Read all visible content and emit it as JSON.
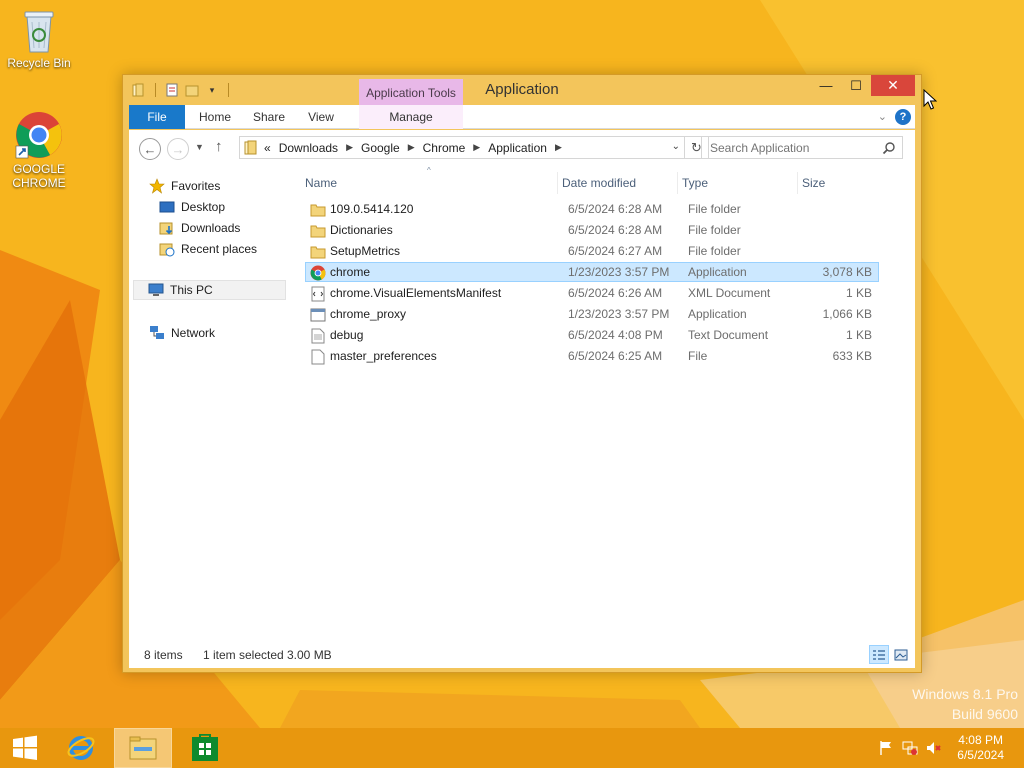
{
  "desktop": {
    "icons": [
      {
        "label": "Recycle Bin",
        "icon": "recycle-bin-icon"
      },
      {
        "label": "GOOGLE CHROME",
        "icon": "chrome-shortcut-icon"
      }
    ],
    "watermark_line1": "Windows 8.1 Pro",
    "watermark_line2": "Build 9600"
  },
  "window": {
    "title": "Application",
    "context_tab_group": "Application Tools",
    "ribbon_tabs": {
      "file": "File",
      "home": "Home",
      "share": "Share",
      "view": "View",
      "manage": "Manage"
    },
    "controls": {
      "minimize": "—",
      "maximize": "☐",
      "close": "✕"
    }
  },
  "address": {
    "overflow": "«",
    "breadcrumbs": [
      "Downloads",
      "Google",
      "Chrome",
      "Application"
    ]
  },
  "search": {
    "placeholder": "Search Application"
  },
  "navpane": {
    "favorites": "Favorites",
    "desktop": "Desktop",
    "downloads": "Downloads",
    "recent": "Recent places",
    "thispc": "This PC",
    "network": "Network"
  },
  "columns": {
    "name": "Name",
    "date": "Date modified",
    "type": "Type",
    "size": "Size"
  },
  "files": [
    {
      "name": "109.0.5414.120",
      "date": "6/5/2024 6:28 AM",
      "type": "File folder",
      "size": "",
      "icon": "folder-icon"
    },
    {
      "name": "Dictionaries",
      "date": "6/5/2024 6:28 AM",
      "type": "File folder",
      "size": "",
      "icon": "folder-icon"
    },
    {
      "name": "SetupMetrics",
      "date": "6/5/2024 6:27 AM",
      "type": "File folder",
      "size": "",
      "icon": "folder-icon"
    },
    {
      "name": "chrome",
      "date": "1/23/2023 3:57 PM",
      "type": "Application",
      "size": "3,078 KB",
      "icon": "chrome-app-icon",
      "selected": true
    },
    {
      "name": "chrome.VisualElementsManifest",
      "date": "6/5/2024 6:26 AM",
      "type": "XML Document",
      "size": "1 KB",
      "icon": "xml-document-icon"
    },
    {
      "name": "chrome_proxy",
      "date": "1/23/2023 3:57 PM",
      "type": "Application",
      "size": "1,066 KB",
      "icon": "application-icon"
    },
    {
      "name": "debug",
      "date": "6/5/2024 4:08 PM",
      "type": "Text Document",
      "size": "1 KB",
      "icon": "text-document-icon"
    },
    {
      "name": "master_preferences",
      "date": "6/5/2024 6:25 AM",
      "type": "File",
      "size": "633 KB",
      "icon": "file-icon"
    }
  ],
  "status": {
    "items": "8 items",
    "selected": "1 item selected",
    "size": "3.00 MB"
  },
  "taskbar": {
    "time": "4:08 PM",
    "date": "6/5/2024"
  },
  "colors": {
    "accent": "#1979ca",
    "selection": "#cce8ff",
    "selection_border": "#99d1ff",
    "window_frame": "#f3c55b",
    "taskbar": "#e8970e",
    "close_button": "#d9463b",
    "context_tab": "#e8b8e8"
  }
}
